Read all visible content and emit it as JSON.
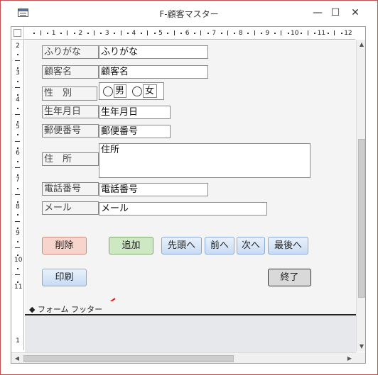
{
  "window": {
    "title": "F-顧客マスター",
    "minimize_glyph": "—",
    "maximize_glyph": "☐",
    "close_glyph": "✕"
  },
  "ruler": {
    "horizontal_numbers": [
      "1",
      "2",
      "3",
      "4",
      "5",
      "6",
      "7",
      "8",
      "9",
      "10",
      "11",
      "12"
    ],
    "vertical_numbers": [
      "2",
      "3",
      "4",
      "5",
      "6",
      "7",
      "8",
      "9",
      "10",
      "11",
      "1"
    ]
  },
  "form": {
    "furigana": {
      "label": "ふりがな",
      "value": "ふりがな"
    },
    "name": {
      "label": "顧客名",
      "value": "顧客名"
    },
    "gender": {
      "label": "性　別",
      "option_male": "男",
      "option_female": "女"
    },
    "birthdate": {
      "label": "生年月日",
      "value": "生年月日"
    },
    "postal_code": {
      "label": "郵便番号",
      "value": "郵便番号"
    },
    "address": {
      "label": "住　所",
      "value": "住所"
    },
    "phone": {
      "label": "電話番号",
      "value": "電話番号"
    },
    "email": {
      "label": "メール",
      "value": "メール"
    }
  },
  "buttons": {
    "delete": "削除",
    "add": "追加",
    "first": "先頭へ",
    "prev": "前へ",
    "next": "次へ",
    "last": "最後へ",
    "print": "印刷",
    "close": "終了"
  },
  "footer": {
    "section_label": "フォーム フッター"
  },
  "colors": {
    "delete_button": "#f8d5cc",
    "add_button": "#cfe8c4",
    "nav_button": "#cfe2f7",
    "close_button": "#d9d9d9",
    "annotation_arrow": "#e02020"
  }
}
